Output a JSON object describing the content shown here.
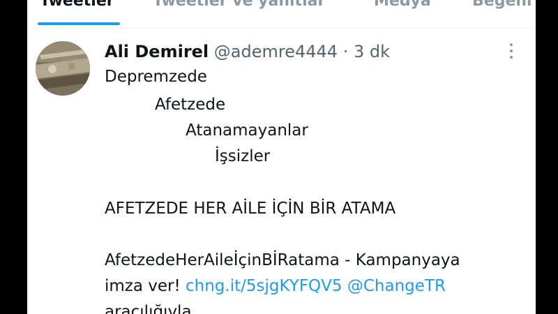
{
  "tabs": [
    {
      "label": "Tweetler",
      "active": true
    },
    {
      "label": "Tweetler ve yanıtlar",
      "active": false
    },
    {
      "label": "Medya",
      "active": false
    },
    {
      "label": "Beğeni",
      "active": false
    }
  ],
  "tweet": {
    "author_name": "Ali Demirel",
    "handle": "@ademre4444",
    "separator": "·",
    "time": "3 dk",
    "lines": [
      "Depremzede",
      "Afetzede",
      "Atanamayanlar",
      "İşsizler",
      "AFETZEDE HER AİLE İÇİN BİR ATAMA",
      "AfetzedeHerAileİçinBİRatama - Kampanyaya",
      "imza ver!",
      "aracılığıyla"
    ],
    "link_url": "chng.it/5sjgKYFQV5",
    "mention": "@ChangeTR"
  },
  "icons": {
    "more": "more-vertical-icon",
    "avatar": "avatar-photo"
  },
  "colors": {
    "accent": "#1d9bf0",
    "text": "#0f1419",
    "secondary": "#536471"
  }
}
